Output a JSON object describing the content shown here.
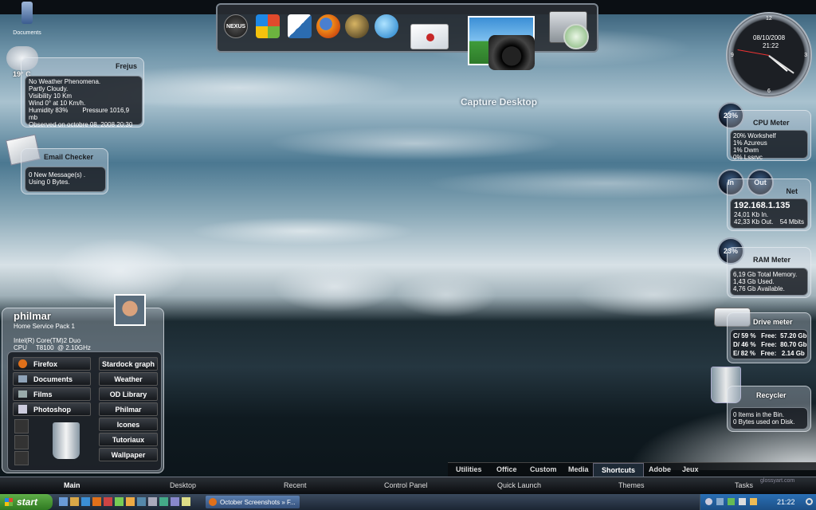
{
  "desktop": {
    "documents_label": "Documents",
    "capture_label": "Capture Desktop"
  },
  "dock": {
    "icons": [
      "nexus-logo-icon",
      "windows-logo-icon",
      "inkscape-icon",
      "firefox-icon",
      "globe-icon",
      "orb-icon",
      "mail-icon",
      "picture-icon",
      "camera-icon",
      "monitor-icon",
      "clock-icon"
    ],
    "nexus_text": "NEXUS"
  },
  "weather": {
    "temp": "19° C",
    "city": "Frejus",
    "lines": [
      "No Weather Phenomena.",
      "Partly Cloudy.",
      "Visibility 10 Km",
      "Wind 0° at 10 Km/h.",
      "Humidity 83%",
      "Observed on octobre 08, 2008 20:30"
    ],
    "pressure": "Pressure 1016,9 mb"
  },
  "email": {
    "title": "Email Checker",
    "lines": [
      "0 New Message(s) .",
      "Using 0 Bytes."
    ]
  },
  "clock": {
    "date": "08/10/2008",
    "time": "21:22",
    "hours": [
      "12",
      "1",
      "2",
      "3",
      "4",
      "5",
      "6",
      "7",
      "8",
      "9",
      "10",
      "11"
    ]
  },
  "cpu": {
    "title": "CPU Meter",
    "percent": "23%",
    "lines": [
      "20% Workshelf",
      "1% Azureus",
      "1% Dwm",
      "0% Lssrvc"
    ]
  },
  "net": {
    "title": "Net",
    "in": "In",
    "out": "Out",
    "ip": "192.168.1.135",
    "in_rate": "24,01 Kb In.",
    "out_rate": "42,33 Kb Out.",
    "speed": "54 Mbits"
  },
  "ram": {
    "title": "RAM Meter",
    "percent": "23%",
    "lines": [
      "6,19 Gb Total Memory.",
      "1,43 Gb Used.",
      "4,76 Gb Available."
    ]
  },
  "drive": {
    "title": "Drive meter",
    "rows": [
      "C/ 59 %   Free:  57.20 Gb",
      "D/ 46 %   Free:  80.70 Gb",
      "E/ 82 %   Free:   2.14 Gb"
    ]
  },
  "recycler": {
    "title": "Recycler",
    "lines": [
      "0 Items in the Bin.",
      "0 Bytes used on Disk."
    ]
  },
  "user": {
    "name": "philmar",
    "edition": "Home Service Pack 1",
    "cpu_model": "Intel(R) Core(TM)2 Duo",
    "cpu_speed": "CPU     T8100  @ 2.10GHz",
    "left_items": [
      "Firefox",
      "Documents",
      "Films",
      "Photoshop"
    ],
    "right_items": [
      "Stardock graph",
      "Weather",
      "OD Library",
      "Philmar",
      "Icones",
      "Tutoriaux",
      "Wallpaper"
    ]
  },
  "dockbar": {
    "tabs": [
      "Utilities",
      "Office",
      "Custom",
      "Media",
      "Shortcuts",
      "Adobe",
      "Jeux"
    ],
    "active": "Shortcuts"
  },
  "tabbar": {
    "tabs": [
      "Main",
      "Desktop",
      "Recent",
      "Control Panel",
      "Quick Launch",
      "Themes",
      "Tasks"
    ],
    "watermark": "glossyart.com"
  },
  "taskbar": {
    "start": "start",
    "window": "October Screenshots » F...",
    "clock": "21:22"
  },
  "colors": {
    "accent": "#3e6fa8",
    "panel": "#12161c",
    "start_green": "#3c8f2e"
  }
}
